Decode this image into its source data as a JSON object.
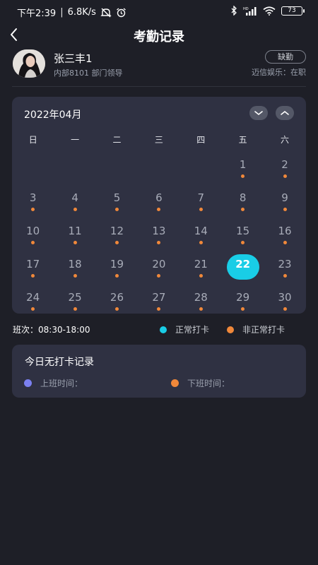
{
  "status_bar": {
    "time": "下午2:39",
    "speed": "6.8K/s",
    "battery": "73"
  },
  "nav": {
    "title": "考勤记录"
  },
  "profile": {
    "name": "张三丰1",
    "dept": "内部8101  部门领导",
    "status_tag": "缺勤",
    "company": "迈信娱乐：在职"
  },
  "calendar": {
    "month_title": "2022年04月",
    "weekdays": [
      "日",
      "一",
      "二",
      "三",
      "四",
      "五",
      "六"
    ],
    "first_weekday_index": 5,
    "days_shown": 30,
    "today": 22
  },
  "legend": {
    "shift": "班次：08:30-18:00",
    "normal_label": "正常打卡",
    "abnormal_label": "非正常打卡"
  },
  "record": {
    "title": "今日无打卡记录",
    "clock_in_label": "上班时间：",
    "clock_out_label": "下班时间："
  },
  "colors": {
    "background": "#1e1f27",
    "card": "#2f3142",
    "accent": "#19cde6",
    "abnormal_dot": "#f0883a",
    "clock_in_dot": "#7b80f0",
    "clock_out_dot": "#f0883a"
  },
  "icons": {
    "back": "chevron-left-icon",
    "prev_month": "chevron-down-icon",
    "next_month": "chevron-up-icon"
  }
}
